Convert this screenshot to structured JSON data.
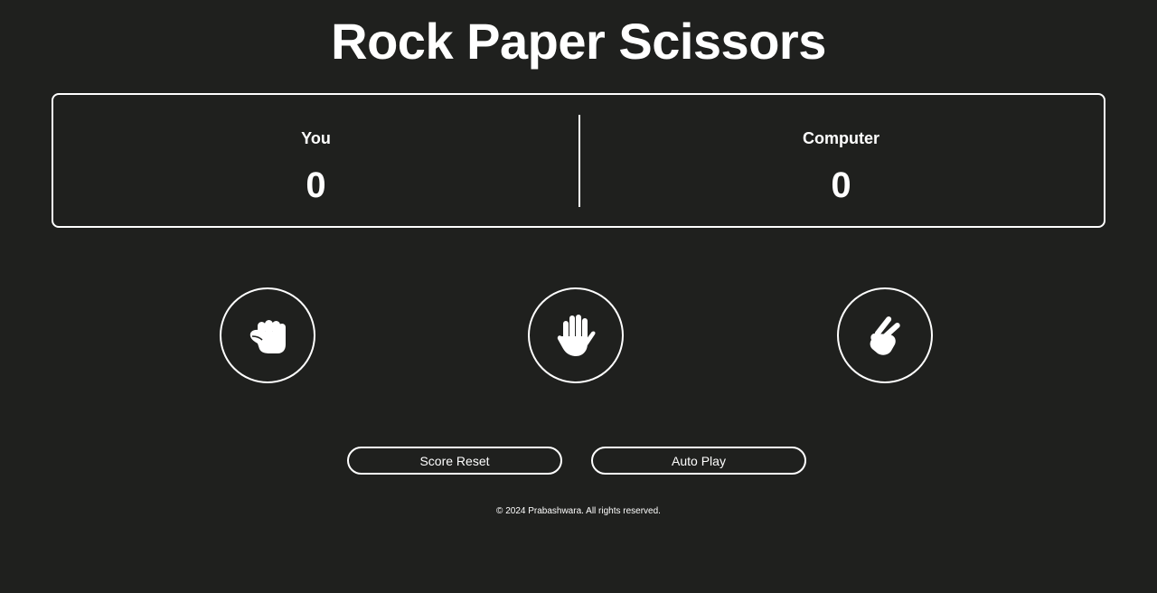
{
  "app": {
    "title": "Rock Paper Scissors"
  },
  "scoreboard": {
    "player": {
      "label": "You",
      "score": "0"
    },
    "computer": {
      "label": "Computer",
      "score": "0"
    }
  },
  "moves": [
    {
      "name": "rock",
      "icon": "rock-fist-icon"
    },
    {
      "name": "paper",
      "icon": "paper-hand-icon"
    },
    {
      "name": "scissors",
      "icon": "scissors-hand-icon"
    }
  ],
  "actions": {
    "reset_label": "Score Reset",
    "autoplay_label": "Auto Play"
  },
  "footer": {
    "text": "© 2024 Prabashwara. All rights reserved."
  },
  "colors": {
    "background": "#1f201e",
    "foreground": "#ffffff"
  }
}
